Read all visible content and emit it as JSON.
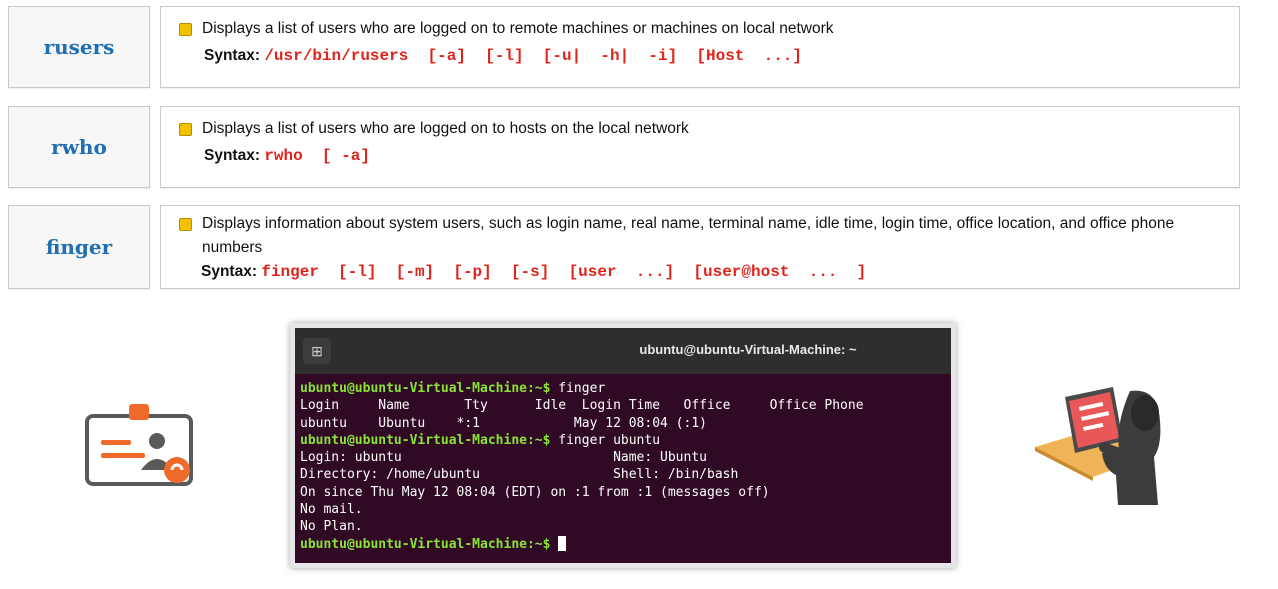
{
  "commands": [
    {
      "name": "rusers",
      "description": "Displays a list of users who are logged on to remote machines or machines on local network",
      "syntax_label": "Syntax",
      "syntax": "/usr/bin/rusers  [-a]  [-l]  [-u|  -h|  -i]  [Host  ...]"
    },
    {
      "name": "rwho",
      "description": "Displays a list of users who are logged on to hosts on the local network",
      "syntax_label": "Syntax",
      "syntax": "rwho  [ -a]"
    },
    {
      "name": "finger",
      "description": "Displays information about system users, such as login name, real name, terminal name, idle time, login time, office location, and office phone numbers",
      "syntax_label": "Syntax",
      "syntax": "finger  [-l]  [-m]  [-p]  [-s]  [user  ...]  [user@host  ...  ]"
    }
  ],
  "terminal": {
    "title": "ubuntu@ubuntu-Virtual-Machine: ~",
    "prompt": "ubuntu@ubuntu-Virtual-Machine:~$",
    "lines": [
      {
        "prompt": true,
        "text": " finger"
      },
      {
        "prompt": false,
        "text": "Login     Name       Tty      Idle  Login Time   Office     Office Phone"
      },
      {
        "prompt": false,
        "text": "ubuntu    Ubuntu    *:1            May 12 08:04 (:1)"
      },
      {
        "prompt": true,
        "text": " finger ubuntu"
      },
      {
        "prompt": false,
        "text": "Login: ubuntu                           Name: Ubuntu"
      },
      {
        "prompt": false,
        "text": "Directory: /home/ubuntu                 Shell: /bin/bash"
      },
      {
        "prompt": false,
        "text": "On since Thu May 12 08:04 (EDT) on :1 from :1 (messages off)"
      },
      {
        "prompt": false,
        "text": "No mail."
      },
      {
        "prompt": false,
        "text": "No Plan."
      },
      {
        "prompt": true,
        "text": " ",
        "cursor": true
      }
    ]
  },
  "icons": {
    "left": "id-card-icon",
    "right": "hacker-laptop-icon"
  }
}
